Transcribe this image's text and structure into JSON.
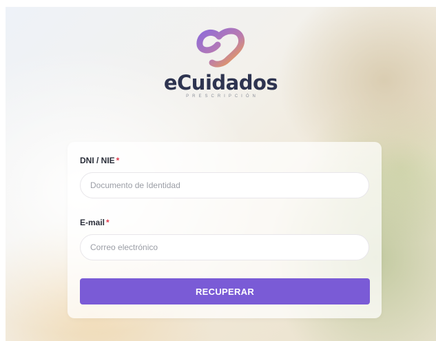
{
  "brand": {
    "name": "eCuidados",
    "tagline": "PRESCRIPCIÓN",
    "logo_icon": "ecuidados-logo-icon",
    "gradient_colors": [
      "#8e6bd8",
      "#f0a24a"
    ]
  },
  "form": {
    "dni_label": "DNI / NIE",
    "dni_required_mark": "*",
    "dni_placeholder": "Documento de Identidad",
    "dni_value": "",
    "email_label": "E-mail",
    "email_required_mark": "*",
    "email_placeholder": "Correo electrónico",
    "email_value": "",
    "submit_label": "RECUPERAR"
  },
  "colors": {
    "accent": "#7a5bd6",
    "required": "#e23b4e",
    "brand_text": "#2e3450"
  }
}
